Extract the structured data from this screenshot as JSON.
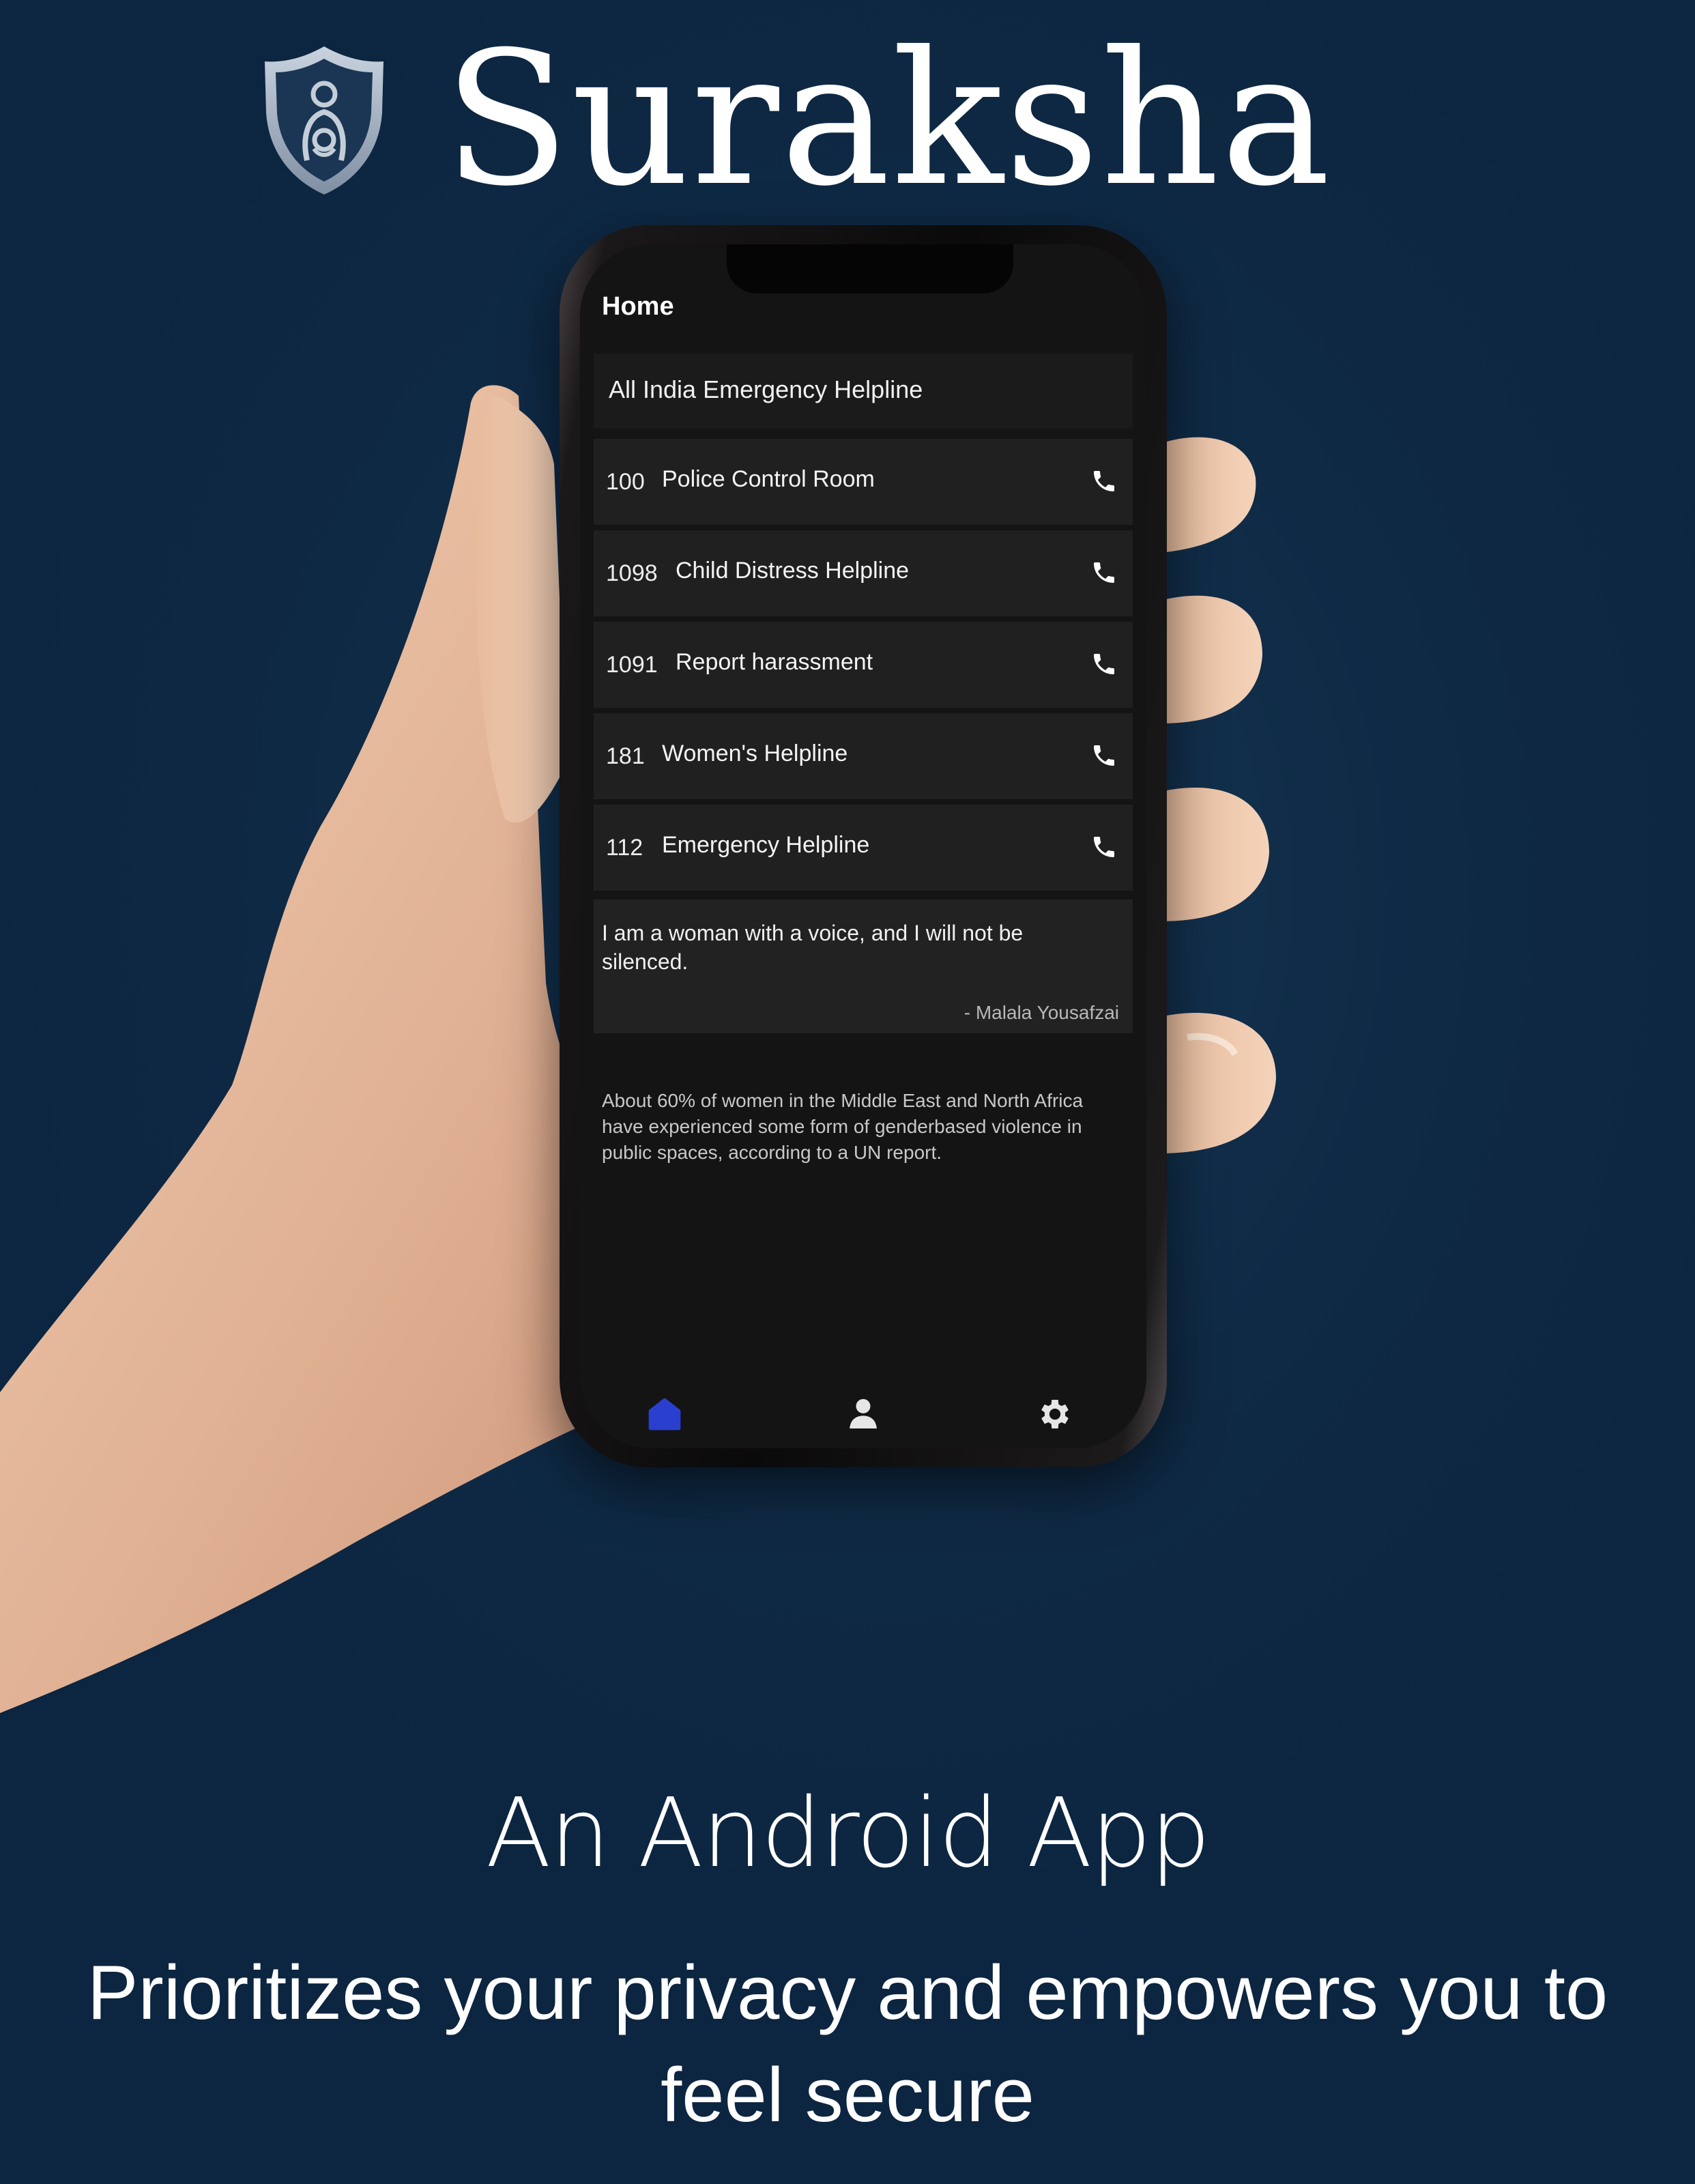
{
  "brand": {
    "title": "Suraksha",
    "logo_icon": "shield-woman-logo-icon"
  },
  "app_screen": {
    "screen_title": "Home",
    "section_header": "All India Emergency Helpline",
    "helplines": [
      {
        "number": "100",
        "name": "Police Control Room",
        "icon": "phone-icon"
      },
      {
        "number": "1098",
        "name": "Child Distress Helpline",
        "icon": "phone-icon"
      },
      {
        "number": "1091",
        "name": "Report harassment",
        "icon": "phone-icon"
      },
      {
        "number": "181",
        "name": "Women's Helpline",
        "icon": "phone-icon"
      },
      {
        "number": "112",
        "name": "Emergency Helpline",
        "icon": "phone-icon"
      }
    ],
    "quote": {
      "text": "I am a woman with a voice, and I will not be silenced.",
      "author": "- Malala Yousafzai"
    },
    "fact": "About 60% of women in the Middle East and North Africa have experienced some form of genderbased violence in public spaces, according to a UN report.",
    "bottom_nav": [
      {
        "icon": "home-icon",
        "active": true
      },
      {
        "icon": "profile-icon",
        "active": false
      },
      {
        "icon": "settings-gear-icon",
        "active": false
      }
    ],
    "colors": {
      "active_nav": "#2a3fd0",
      "screen_bg": "#141414",
      "card_bg": "#202020"
    }
  },
  "subtitle": "An Android App",
  "tagline": "Prioritizes your privacy and empowers you to feel secure",
  "colors": {
    "page_background": "#0f2a45",
    "text": "#ffffff"
  }
}
